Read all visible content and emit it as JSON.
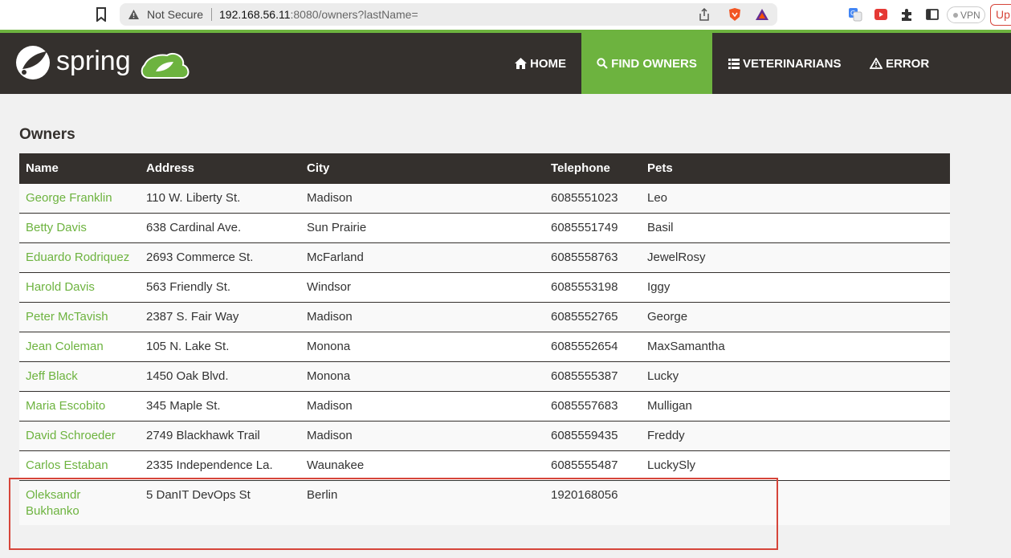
{
  "browser": {
    "security_label": "Not Secure",
    "url_host": "192.168.56.11",
    "url_rest": ":8080/owners?lastName=",
    "vpn_label": "VPN",
    "update_label": "Up"
  },
  "navbar": {
    "brand": "spring",
    "items": [
      {
        "label": "HOME",
        "icon": "home-icon"
      },
      {
        "label": "FIND OWNERS",
        "icon": "search-icon",
        "active": true
      },
      {
        "label": "VETERINARIANS",
        "icon": "list-icon"
      },
      {
        "label": "ERROR",
        "icon": "warning-icon"
      }
    ],
    "accent_color": "#6db33f",
    "bg_color": "#34302d"
  },
  "page": {
    "title": "Owners",
    "columns": [
      "Name",
      "Address",
      "City",
      "Telephone",
      "Pets"
    ],
    "rows": [
      [
        "George Franklin",
        "110 W. Liberty St.",
        "Madison",
        "6085551023",
        "Leo"
      ],
      [
        "Betty Davis",
        "638 Cardinal Ave.",
        "Sun Prairie",
        "6085551749",
        "Basil"
      ],
      [
        "Eduardo Rodriquez",
        "2693 Commerce St.",
        "McFarland",
        "6085558763",
        "JewelRosy"
      ],
      [
        "Harold Davis",
        "563 Friendly St.",
        "Windsor",
        "6085553198",
        "Iggy"
      ],
      [
        "Peter McTavish",
        "2387 S. Fair Way",
        "Madison",
        "6085552765",
        "George"
      ],
      [
        "Jean Coleman",
        "105 N. Lake St.",
        "Monona",
        "6085552654",
        "MaxSamantha"
      ],
      [
        "Jeff Black",
        "1450 Oak Blvd.",
        "Monona",
        "6085555387",
        "Lucky"
      ],
      [
        "Maria Escobito",
        "345 Maple St.",
        "Madison",
        "6085557683",
        "Mulligan"
      ],
      [
        "David Schroeder",
        "2749 Blackhawk Trail",
        "Madison",
        "6085559435",
        "Freddy"
      ],
      [
        "Carlos Estaban",
        "2335 Independence La.",
        "Waunakee",
        "6085555487",
        "LuckySly"
      ],
      [
        "Oleksandr Bukhanko",
        "5 DanIT DevOps St",
        "Berlin",
        "1920168056",
        ""
      ]
    ]
  }
}
